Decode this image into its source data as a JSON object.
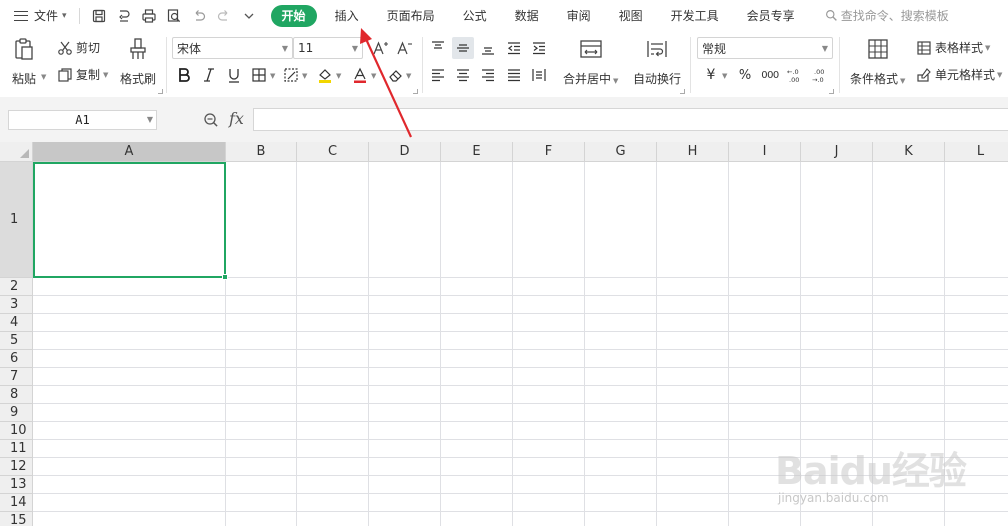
{
  "menubar": {
    "file_label": "文件",
    "tabs": [
      "开始",
      "插入",
      "页面布局",
      "公式",
      "数据",
      "审阅",
      "视图",
      "开发工具",
      "会员专享"
    ],
    "active_tab": "开始",
    "search_placeholder": "查找命令、搜索模板"
  },
  "ribbon": {
    "paste": "粘贴",
    "cut": "剪切",
    "copy": "复制",
    "format_painter": "格式刷",
    "font_name": "宋体",
    "font_size": "11",
    "merge_center": "合并居中",
    "wrap_text": "自动换行",
    "number_format": "常规",
    "percent": "%",
    "thousands": "000",
    "conditional_format": "条件格式",
    "table_style": "表格样式",
    "cell_style": "单元格样式"
  },
  "formula_bar": {
    "name_box": "A1",
    "fx_label": "fx",
    "formula": ""
  },
  "sheet": {
    "columns": [
      "A",
      "B",
      "C",
      "D",
      "E",
      "F",
      "G",
      "H",
      "I",
      "J",
      "K",
      "L"
    ],
    "rows": [
      "1",
      "2",
      "3",
      "4",
      "5",
      "6",
      "7",
      "8",
      "9",
      "10",
      "11",
      "12",
      "13",
      "14",
      "15"
    ],
    "active_cell": "A1",
    "active_column": "A",
    "active_row": "1"
  },
  "watermark": {
    "main": "Baidu经验",
    "sub": "jingyan.baidu.com"
  },
  "colors": {
    "accent_green": "#20a662",
    "annotation_red": "#e0282d"
  },
  "icons": {
    "menu": "hamburger-icon",
    "save": "save-icon",
    "print": "print-icon",
    "undo": "undo-icon",
    "redo": "redo-icon",
    "search": "search-icon",
    "zoom": "zoom-icon"
  }
}
